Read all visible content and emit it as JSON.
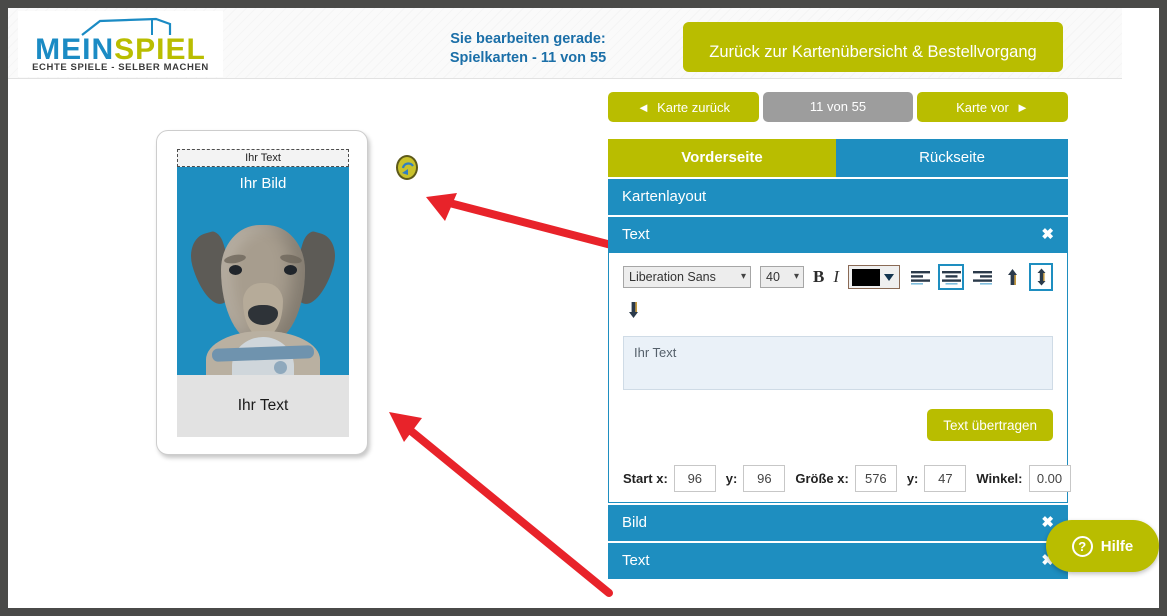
{
  "colors": {
    "brand_yellow": "#b9bd00",
    "brand_blue": "#1e8ec0",
    "logo_blue": "#1b8bc4",
    "page_border": "#4a4a48",
    "arrow_red": "#e8232a",
    "grey_button": "#9d9d9d"
  },
  "header": {
    "logo": {
      "word_a": "MEIN",
      "word_b": "SPIEL",
      "tagline": "ECHTE SPIELE - SELBER MACHEN"
    },
    "edit_info_line1": "Sie bearbeiten gerade:",
    "edit_info_line2": "Spielkarten - 11 von 55",
    "overview_button": "Zurück zur Kartenübersicht & Bestellvorgang"
  },
  "pager": {
    "prev_label": "Karte zurück",
    "prev_icon": "chevron-left-icon",
    "counter": "11 von 55",
    "next_label": "Karte vor",
    "next_icon": "chevron-right-icon"
  },
  "card_preview": {
    "top_text": "Ihr Text",
    "image_label": "Ihr Bild",
    "bottom_text": "Ihr Text",
    "rotate_icon": "rotate-icon"
  },
  "panel": {
    "tabs": [
      {
        "label": "Vorderseite",
        "active": true
      },
      {
        "label": "Rückseite",
        "active": false
      }
    ],
    "sections": [
      {
        "label": "Kartenlayout",
        "closable": false
      },
      {
        "label": "Text",
        "closable": true,
        "expanded": true
      },
      {
        "label": "Bild",
        "closable": true,
        "expanded": false
      },
      {
        "label": "Text",
        "closable": true,
        "expanded": false
      }
    ],
    "close_icon": "close-icon",
    "text_section": {
      "toolbar": {
        "font_family": "Liberation Sans",
        "font_size": "40",
        "bold_label": "B",
        "italic_label": "I",
        "color_value": "#000000",
        "align_left_icon": "align-left-icon",
        "align_center_icon": "align-center-icon",
        "align_right_icon": "align-right-icon",
        "valign_top_icon": "align-top-icon",
        "valign_middle_icon": "align-middle-icon",
        "valign_bottom_icon": "align-bottom-icon",
        "align_center_active": true,
        "valign_middle_active": true
      },
      "textarea_value": "Ihr Text",
      "textarea_placeholder": "Ihr Text",
      "transfer_button": "Text übertragen",
      "coords": {
        "start_x_label": "Start x:",
        "start_x_value": "96",
        "start_y_label": "y:",
        "start_y_value": "96",
        "size_x_label": "Größe x:",
        "size_x_value": "576",
        "size_y_label": "y:",
        "size_y_value": "47",
        "angle_label": "Winkel:",
        "angle_value": "0.00"
      }
    }
  },
  "help": {
    "label": "Hilfe",
    "icon": "question-circle-icon",
    "glyph": "?"
  }
}
